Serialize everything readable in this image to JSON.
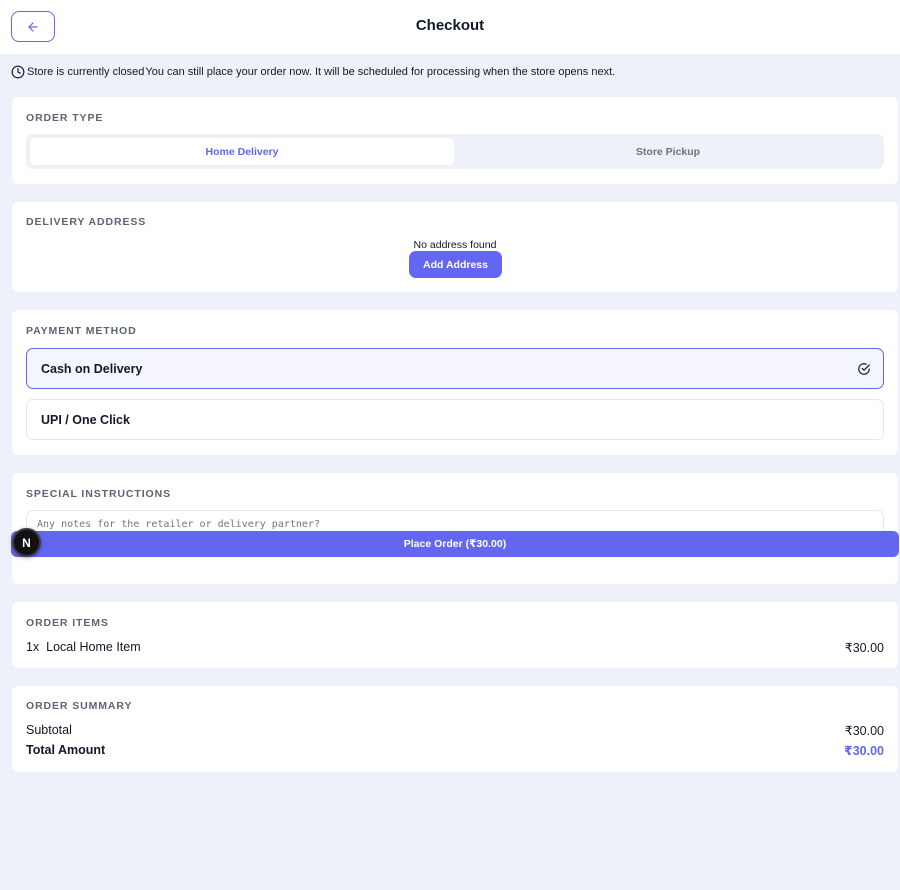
{
  "header": {
    "title": "Checkout"
  },
  "notice": {
    "closed_text": "Store is currently closed",
    "message": "You can still place your order now. It will be scheduled for processing when the store opens next."
  },
  "order_type": {
    "title": "ORDER TYPE",
    "options": [
      {
        "label": "Home Delivery",
        "selected": true
      },
      {
        "label": "Store Pickup",
        "selected": false
      }
    ]
  },
  "delivery": {
    "title": "DELIVERY ADDRESS",
    "empty_text": "No address found",
    "add_label": "Add Address"
  },
  "payment": {
    "title": "PAYMENT METHOD",
    "options": [
      {
        "label": "Cash on Delivery",
        "selected": true
      },
      {
        "label": "UPI / One Click",
        "selected": false
      }
    ]
  },
  "instructions": {
    "title": "SPECIAL INSTRUCTIONS",
    "placeholder": "Any notes for the retailer or delivery partner?"
  },
  "place_order": {
    "label": "Place Order (₹30.00)"
  },
  "dev_badge": {
    "letter": "N"
  },
  "items": {
    "title": "ORDER ITEMS",
    "list": [
      {
        "qty": "1x",
        "name": "Local Home Item",
        "price": "₹30.00"
      }
    ]
  },
  "summary": {
    "title": "ORDER SUMMARY",
    "subtotal_label": "Subtotal",
    "subtotal_value": "₹30.00",
    "total_label": "Total Amount",
    "total_value": "₹30.00"
  },
  "colors": {
    "accent": "#6366f1",
    "background": "#eef1f9"
  }
}
